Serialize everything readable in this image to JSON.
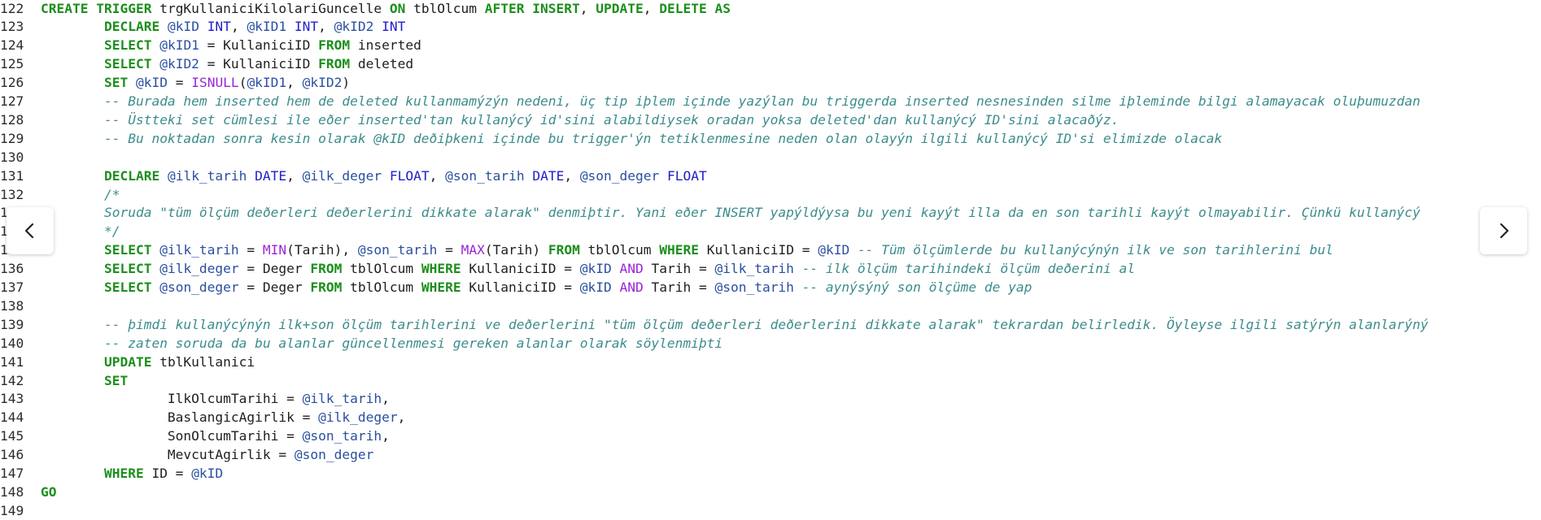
{
  "lines": [
    {
      "num": "122",
      "tokens": [
        [
          "kw",
          "CREATE TRIGGER"
        ],
        [
          "id",
          " trgKullaniciKilolariGuncelle "
        ],
        [
          "kw",
          "ON"
        ],
        [
          "id",
          " tblOlcum "
        ],
        [
          "kw",
          "AFTER INSERT"
        ],
        [
          "id",
          ", "
        ],
        [
          "kw",
          "UPDATE"
        ],
        [
          "id",
          ", "
        ],
        [
          "kw",
          "DELETE AS"
        ]
      ]
    },
    {
      "num": "123",
      "tokens": [
        [
          "id",
          "        "
        ],
        [
          "kw",
          "DECLARE"
        ],
        [
          "id",
          " "
        ],
        [
          "var",
          "@kID"
        ],
        [
          "id",
          " "
        ],
        [
          "ty",
          "INT"
        ],
        [
          "id",
          ", "
        ],
        [
          "var",
          "@kID1"
        ],
        [
          "id",
          " "
        ],
        [
          "ty",
          "INT"
        ],
        [
          "id",
          ", "
        ],
        [
          "var",
          "@kID2"
        ],
        [
          "id",
          " "
        ],
        [
          "ty",
          "INT"
        ]
      ]
    },
    {
      "num": "124",
      "tokens": [
        [
          "id",
          "        "
        ],
        [
          "kw",
          "SELECT"
        ],
        [
          "id",
          " "
        ],
        [
          "var",
          "@kID1"
        ],
        [
          "id",
          " = KullaniciID "
        ],
        [
          "kw",
          "FROM"
        ],
        [
          "id",
          " inserted"
        ]
      ]
    },
    {
      "num": "125",
      "tokens": [
        [
          "id",
          "        "
        ],
        [
          "kw",
          "SELECT"
        ],
        [
          "id",
          " "
        ],
        [
          "var",
          "@kID2"
        ],
        [
          "id",
          " = KullaniciID "
        ],
        [
          "kw",
          "FROM"
        ],
        [
          "id",
          " deleted"
        ]
      ]
    },
    {
      "num": "126",
      "tokens": [
        [
          "id",
          "        "
        ],
        [
          "kw",
          "SET"
        ],
        [
          "id",
          " "
        ],
        [
          "var",
          "@kID"
        ],
        [
          "id",
          " = "
        ],
        [
          "fn",
          "ISNULL"
        ],
        [
          "id",
          "("
        ],
        [
          "var",
          "@kID1"
        ],
        [
          "id",
          ", "
        ],
        [
          "var",
          "@kID2"
        ],
        [
          "id",
          ")"
        ]
      ]
    },
    {
      "num": "127",
      "tokens": [
        [
          "id",
          "        "
        ],
        [
          "cm",
          "-- Burada hem inserted hem de deleted kullanmamýzýn nedeni, üç tip iþlem içinde yazýlan bu triggerda inserted nesnesinden silme iþleminde bilgi alamayacak oluþumuzdan"
        ]
      ]
    },
    {
      "num": "128",
      "tokens": [
        [
          "id",
          "        "
        ],
        [
          "cm",
          "-- Üstteki set cümlesi ile eðer inserted'tan kullanýcý id'sini alabildiysek oradan yoksa deleted'dan kullanýcý ID'sini alacaðýz."
        ]
      ]
    },
    {
      "num": "129",
      "tokens": [
        [
          "id",
          "        "
        ],
        [
          "cm",
          "-- Bu noktadan sonra kesin olarak @kID deðiþkeni içinde bu trigger'ýn tetiklenmesine neden olan olayýn ilgili kullanýcý ID'si elimizde olacak"
        ]
      ]
    },
    {
      "num": "130",
      "tokens": []
    },
    {
      "num": "131",
      "tokens": [
        [
          "id",
          "        "
        ],
        [
          "kw",
          "DECLARE"
        ],
        [
          "id",
          " "
        ],
        [
          "var",
          "@ilk_tarih"
        ],
        [
          "id",
          " "
        ],
        [
          "ty",
          "DATE"
        ],
        [
          "id",
          ", "
        ],
        [
          "var",
          "@ilk_deger"
        ],
        [
          "id",
          " "
        ],
        [
          "ty",
          "FLOAT"
        ],
        [
          "id",
          ", "
        ],
        [
          "var",
          "@son_tarih"
        ],
        [
          "id",
          " "
        ],
        [
          "ty",
          "DATE"
        ],
        [
          "id",
          ", "
        ],
        [
          "var",
          "@son_deger"
        ],
        [
          "id",
          " "
        ],
        [
          "ty",
          "FLOAT"
        ]
      ]
    },
    {
      "num": "132",
      "tokens": [
        [
          "id",
          "        "
        ],
        [
          "cm",
          "/*"
        ]
      ]
    },
    {
      "num": "133",
      "tokens": [
        [
          "id",
          "        "
        ],
        [
          "cm",
          "Soruda \"tüm ölçüm deðerleri deðerlerini dikkate alarak\" denmiþtir. Yani eðer INSERT yapýldýysa bu yeni kayýt illa da en son tarihli kayýt olmayabilir. Çünkü kullanýcý"
        ]
      ]
    },
    {
      "num": "134",
      "tokens": [
        [
          "id",
          "        "
        ],
        [
          "cm",
          "*/"
        ]
      ]
    },
    {
      "num": "135",
      "tokens": [
        [
          "id",
          "        "
        ],
        [
          "kw",
          "SELECT"
        ],
        [
          "id",
          " "
        ],
        [
          "var",
          "@ilk_tarih"
        ],
        [
          "id",
          " = "
        ],
        [
          "fn",
          "MIN"
        ],
        [
          "id",
          "(Tarih), "
        ],
        [
          "var",
          "@son_tarih"
        ],
        [
          "id",
          " = "
        ],
        [
          "fn",
          "MAX"
        ],
        [
          "id",
          "(Tarih) "
        ],
        [
          "kw",
          "FROM"
        ],
        [
          "id",
          " tblOlcum "
        ],
        [
          "kw",
          "WHERE"
        ],
        [
          "id",
          " KullaniciID = "
        ],
        [
          "var",
          "@kID"
        ],
        [
          "id",
          " "
        ],
        [
          "cm",
          "-- Tüm ölçümlerde bu kullanýcýnýn ilk ve son tarihlerini bul"
        ]
      ]
    },
    {
      "num": "136",
      "tokens": [
        [
          "id",
          "        "
        ],
        [
          "kw",
          "SELECT"
        ],
        [
          "id",
          " "
        ],
        [
          "var",
          "@ilk_deger"
        ],
        [
          "id",
          " = Deger "
        ],
        [
          "kw",
          "FROM"
        ],
        [
          "id",
          " tblOlcum "
        ],
        [
          "kw",
          "WHERE"
        ],
        [
          "id",
          " KullaniciID = "
        ],
        [
          "var",
          "@kID"
        ],
        [
          "id",
          " "
        ],
        [
          "fn",
          "AND"
        ],
        [
          "id",
          " Tarih = "
        ],
        [
          "var",
          "@ilk_tarih"
        ],
        [
          "id",
          " "
        ],
        [
          "cm",
          "-- ilk ölçüm tarihindeki ölçüm deðerini al"
        ]
      ]
    },
    {
      "num": "137",
      "tokens": [
        [
          "id",
          "        "
        ],
        [
          "kw",
          "SELECT"
        ],
        [
          "id",
          " "
        ],
        [
          "var",
          "@son_deger"
        ],
        [
          "id",
          " = Deger "
        ],
        [
          "kw",
          "FROM"
        ],
        [
          "id",
          " tblOlcum "
        ],
        [
          "kw",
          "WHERE"
        ],
        [
          "id",
          " KullaniciID = "
        ],
        [
          "var",
          "@kID"
        ],
        [
          "id",
          " "
        ],
        [
          "fn",
          "AND"
        ],
        [
          "id",
          " Tarih = "
        ],
        [
          "var",
          "@son_tarih"
        ],
        [
          "id",
          " "
        ],
        [
          "cm",
          "-- aynýsýný son ölçüme de yap"
        ]
      ]
    },
    {
      "num": "138",
      "tokens": []
    },
    {
      "num": "139",
      "tokens": [
        [
          "id",
          "        "
        ],
        [
          "cm",
          "-- þimdi kullanýcýnýn ilk+son ölçüm tarihlerini ve deðerlerini \"tüm ölçüm deðerleri deðerlerini dikkate alarak\" tekrardan belirledik. Öyleyse ilgili satýrýn alanlarýný"
        ]
      ]
    },
    {
      "num": "140",
      "tokens": [
        [
          "id",
          "        "
        ],
        [
          "cm",
          "-- zaten soruda da bu alanlar güncellenmesi gereken alanlar olarak söylenmiþti"
        ]
      ]
    },
    {
      "num": "141",
      "tokens": [
        [
          "id",
          "        "
        ],
        [
          "kw",
          "UPDATE"
        ],
        [
          "id",
          " tblKullanici"
        ]
      ]
    },
    {
      "num": "142",
      "tokens": [
        [
          "id",
          "        "
        ],
        [
          "kw",
          "SET"
        ]
      ]
    },
    {
      "num": "143",
      "tokens": [
        [
          "id",
          "                IlkOlcumTarihi = "
        ],
        [
          "var",
          "@ilk_tarih"
        ],
        [
          "id",
          ","
        ]
      ]
    },
    {
      "num": "144",
      "tokens": [
        [
          "id",
          "                BaslangicAgirlik = "
        ],
        [
          "var",
          "@ilk_deger"
        ],
        [
          "id",
          ","
        ]
      ]
    },
    {
      "num": "145",
      "tokens": [
        [
          "id",
          "                SonOlcumTarihi = "
        ],
        [
          "var",
          "@son_tarih"
        ],
        [
          "id",
          ","
        ]
      ]
    },
    {
      "num": "146",
      "tokens": [
        [
          "id",
          "                MevcutAgirlik = "
        ],
        [
          "var",
          "@son_deger"
        ]
      ]
    },
    {
      "num": "147",
      "tokens": [
        [
          "id",
          "        "
        ],
        [
          "kw",
          "WHERE"
        ],
        [
          "id",
          " ID = "
        ],
        [
          "var",
          "@kID"
        ]
      ]
    },
    {
      "num": "148",
      "tokens": [
        [
          "kw",
          "GO"
        ]
      ]
    },
    {
      "num": "149",
      "tokens": []
    }
  ],
  "nav": {
    "prev_icon": "chevron-left-icon",
    "next_icon": "chevron-right-icon"
  },
  "colors": {
    "keyword": "#1c8f1c",
    "type": "#2020c8",
    "function": "#9a24d6",
    "variable": "#2a4fa0",
    "comment": "#3d8c8c"
  }
}
